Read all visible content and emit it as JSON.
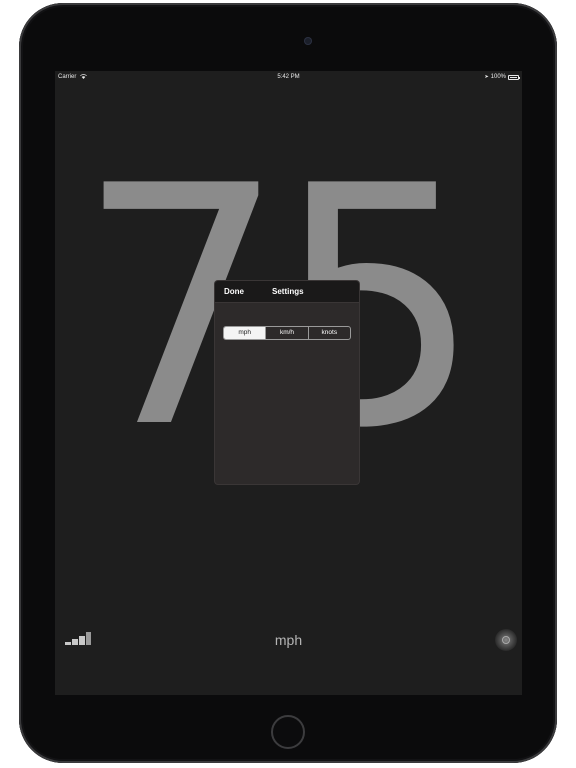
{
  "status_bar": {
    "carrier": "Carrier",
    "time": "5:42 PM",
    "battery": "100%",
    "icons": [
      "wifi-icon",
      "location-arrow-icon",
      "battery-icon"
    ]
  },
  "speed": {
    "value": "75",
    "color": "#8b8b8b"
  },
  "settings_popover": {
    "done_label": "Done",
    "title": "Settings",
    "units": [
      {
        "label": "mph",
        "selected": true
      },
      {
        "label": "km/h",
        "selected": false
      },
      {
        "label": "knots",
        "selected": false
      }
    ]
  },
  "bottom_bar": {
    "unit_label": "mph",
    "icons": [
      "signal-strength-icon",
      "info-icon"
    ]
  },
  "colors": {
    "screen_background": "#1e1e1e",
    "popover_background": "#2d2a2a",
    "segment_selected": "#f4f4f4"
  }
}
